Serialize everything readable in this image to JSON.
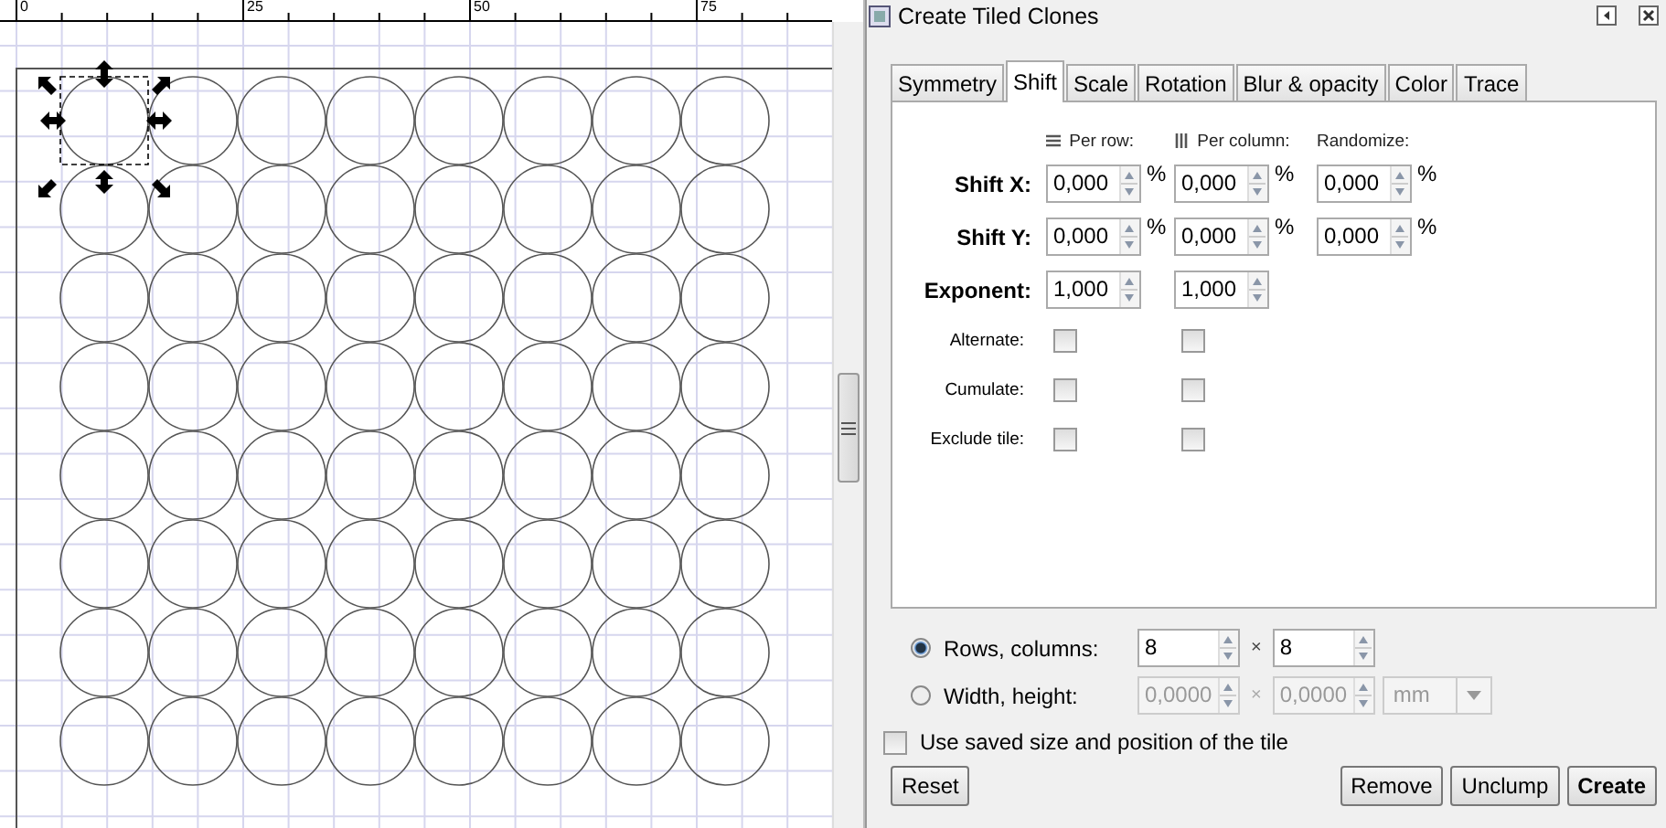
{
  "ruler": {
    "labels": [
      "0",
      "25",
      "50",
      "75"
    ]
  },
  "dialog": {
    "title": "Create Tiled Clones",
    "tabs": [
      {
        "label": "Symmetry",
        "selected": false
      },
      {
        "label": "Shift",
        "selected": true
      },
      {
        "label": "Scale",
        "selected": false
      },
      {
        "label": "Rotation",
        "selected": false
      },
      {
        "label": "Blur & opacity",
        "selected": false
      },
      {
        "label": "Color",
        "selected": false
      },
      {
        "label": "Trace",
        "selected": false
      }
    ],
    "column_headers": [
      {
        "label": "Per row:"
      },
      {
        "label": "Per column:"
      },
      {
        "label": "Randomize:"
      }
    ],
    "rows": [
      {
        "kind": "spin",
        "label": "Shift X:",
        "fields": [
          {
            "value": "0,000",
            "unit": "%"
          },
          {
            "value": "0,000",
            "unit": "%"
          },
          {
            "value": "0,000",
            "unit": "%"
          }
        ]
      },
      {
        "kind": "spin",
        "label": "Shift Y:",
        "fields": [
          {
            "value": "0,000",
            "unit": "%"
          },
          {
            "value": "0,000",
            "unit": "%"
          },
          {
            "value": "0,000",
            "unit": "%"
          }
        ]
      },
      {
        "kind": "spin",
        "label": "Exponent:",
        "fields": [
          {
            "value": "1,000"
          },
          {
            "value": "1,000"
          }
        ]
      },
      {
        "kind": "check",
        "label": "Alternate:",
        "checks": [
          false,
          false
        ]
      },
      {
        "kind": "check",
        "label": "Cumulate:",
        "checks": [
          false,
          false
        ]
      },
      {
        "kind": "check",
        "label": "Exclude tile:",
        "checks": [
          false,
          false
        ]
      }
    ],
    "size_options": [
      {
        "label": "Rows, columns:",
        "selected": true,
        "disabled": false,
        "values": [
          "8",
          "8"
        ],
        "separator": "×"
      },
      {
        "label": "Width, height:",
        "selected": false,
        "disabled": true,
        "values": [
          "0,0000",
          "0,0000"
        ],
        "separator": "×",
        "unit": "mm"
      }
    ],
    "use_saved": {
      "label": "Use saved size and position of the tile",
      "checked": false
    },
    "buttons": [
      {
        "label": "Reset"
      },
      {
        "label": "Remove"
      },
      {
        "label": "Unclump"
      },
      {
        "label": "Create"
      }
    ]
  }
}
